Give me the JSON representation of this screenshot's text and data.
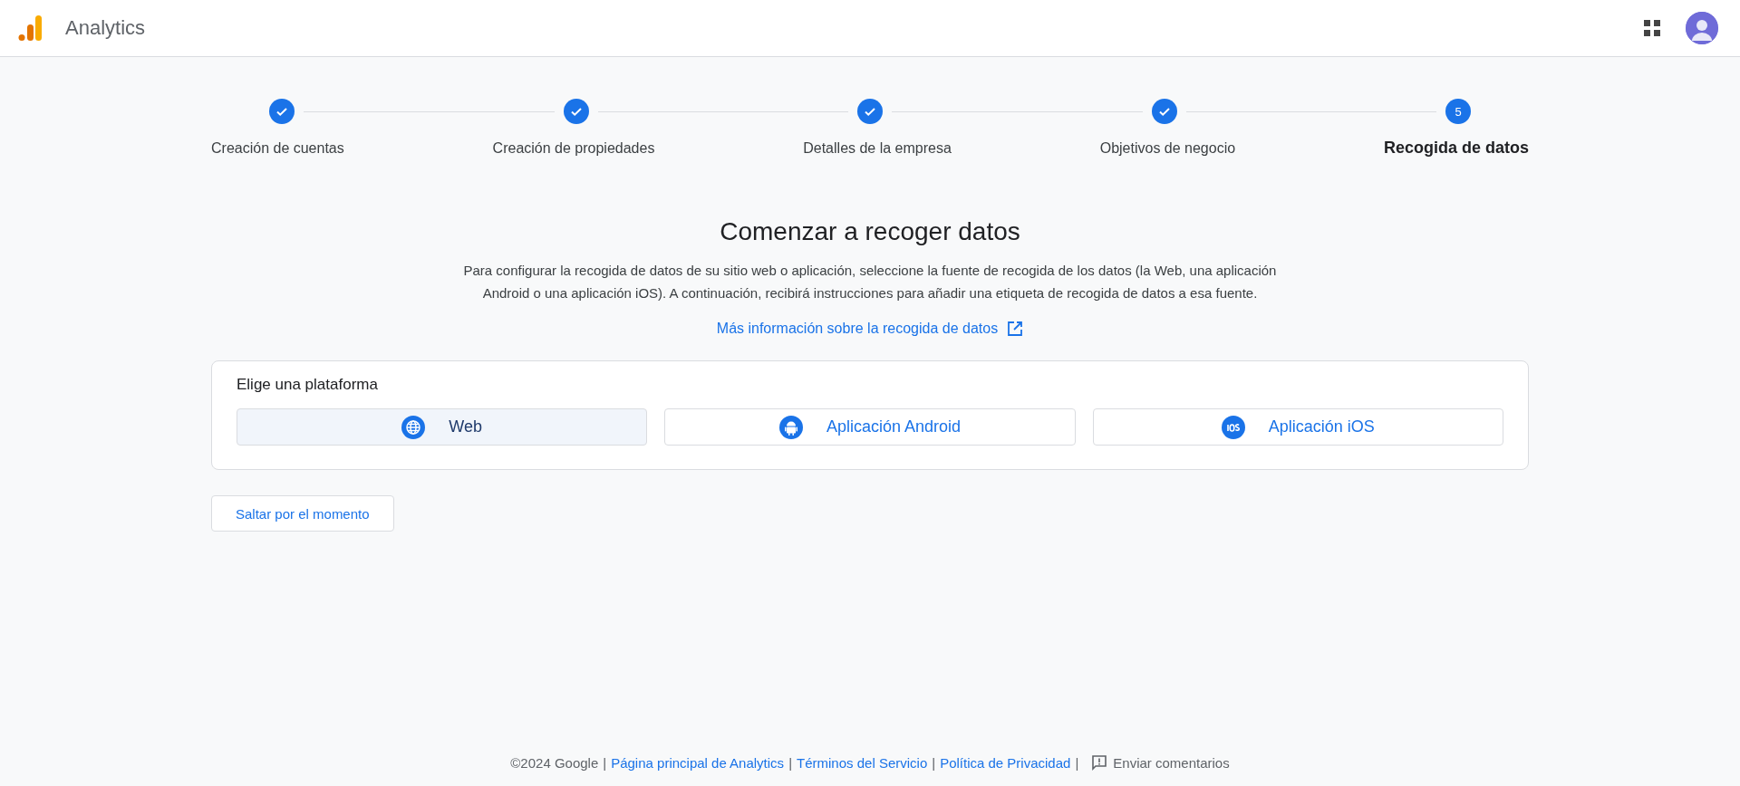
{
  "header": {
    "app_name": "Analytics"
  },
  "stepper": {
    "steps": [
      {
        "label": "Creación de cuentas",
        "done": true
      },
      {
        "label": "Creación de propiedades",
        "done": true
      },
      {
        "label": "Detalles de la empresa",
        "done": true
      },
      {
        "label": "Objetivos de negocio",
        "done": true
      },
      {
        "label": "Recogida de datos",
        "done": false,
        "number": "5"
      }
    ]
  },
  "title": "Comenzar a recoger datos",
  "description": "Para configurar la recogida de datos de su sitio web o aplicación, seleccione la fuente de recogida de los datos (la Web, una aplicación Android o una aplicación iOS). A continuación, recibirá instrucciones para añadir una etiqueta de recogida de datos a esa fuente.",
  "learn_more_link": "Más información sobre la recogida de datos",
  "platform_card": {
    "heading": "Elige una plataforma",
    "platforms": [
      {
        "label": "Web",
        "kind": "web",
        "selected": true
      },
      {
        "label": "Aplicación Android",
        "kind": "android",
        "selected": false
      },
      {
        "label": "Aplicación iOS",
        "kind": "ios",
        "selected": false
      }
    ]
  },
  "skip_button": "Saltar por el momento",
  "footer": {
    "items": [
      {
        "kind": "text",
        "text": "©2024 Google"
      },
      {
        "kind": "separator",
        "text": "|"
      },
      {
        "kind": "link",
        "text": "Página principal de Analytics"
      },
      {
        "kind": "separator",
        "text": "|"
      },
      {
        "kind": "link",
        "text": "Términos del Servicio"
      },
      {
        "kind": "separator",
        "text": "|"
      },
      {
        "kind": "link",
        "text": "Política de Privacidad"
      },
      {
        "kind": "separator",
        "text": "|"
      },
      {
        "kind": "feedback",
        "text": "Enviar comentarios"
      }
    ]
  }
}
